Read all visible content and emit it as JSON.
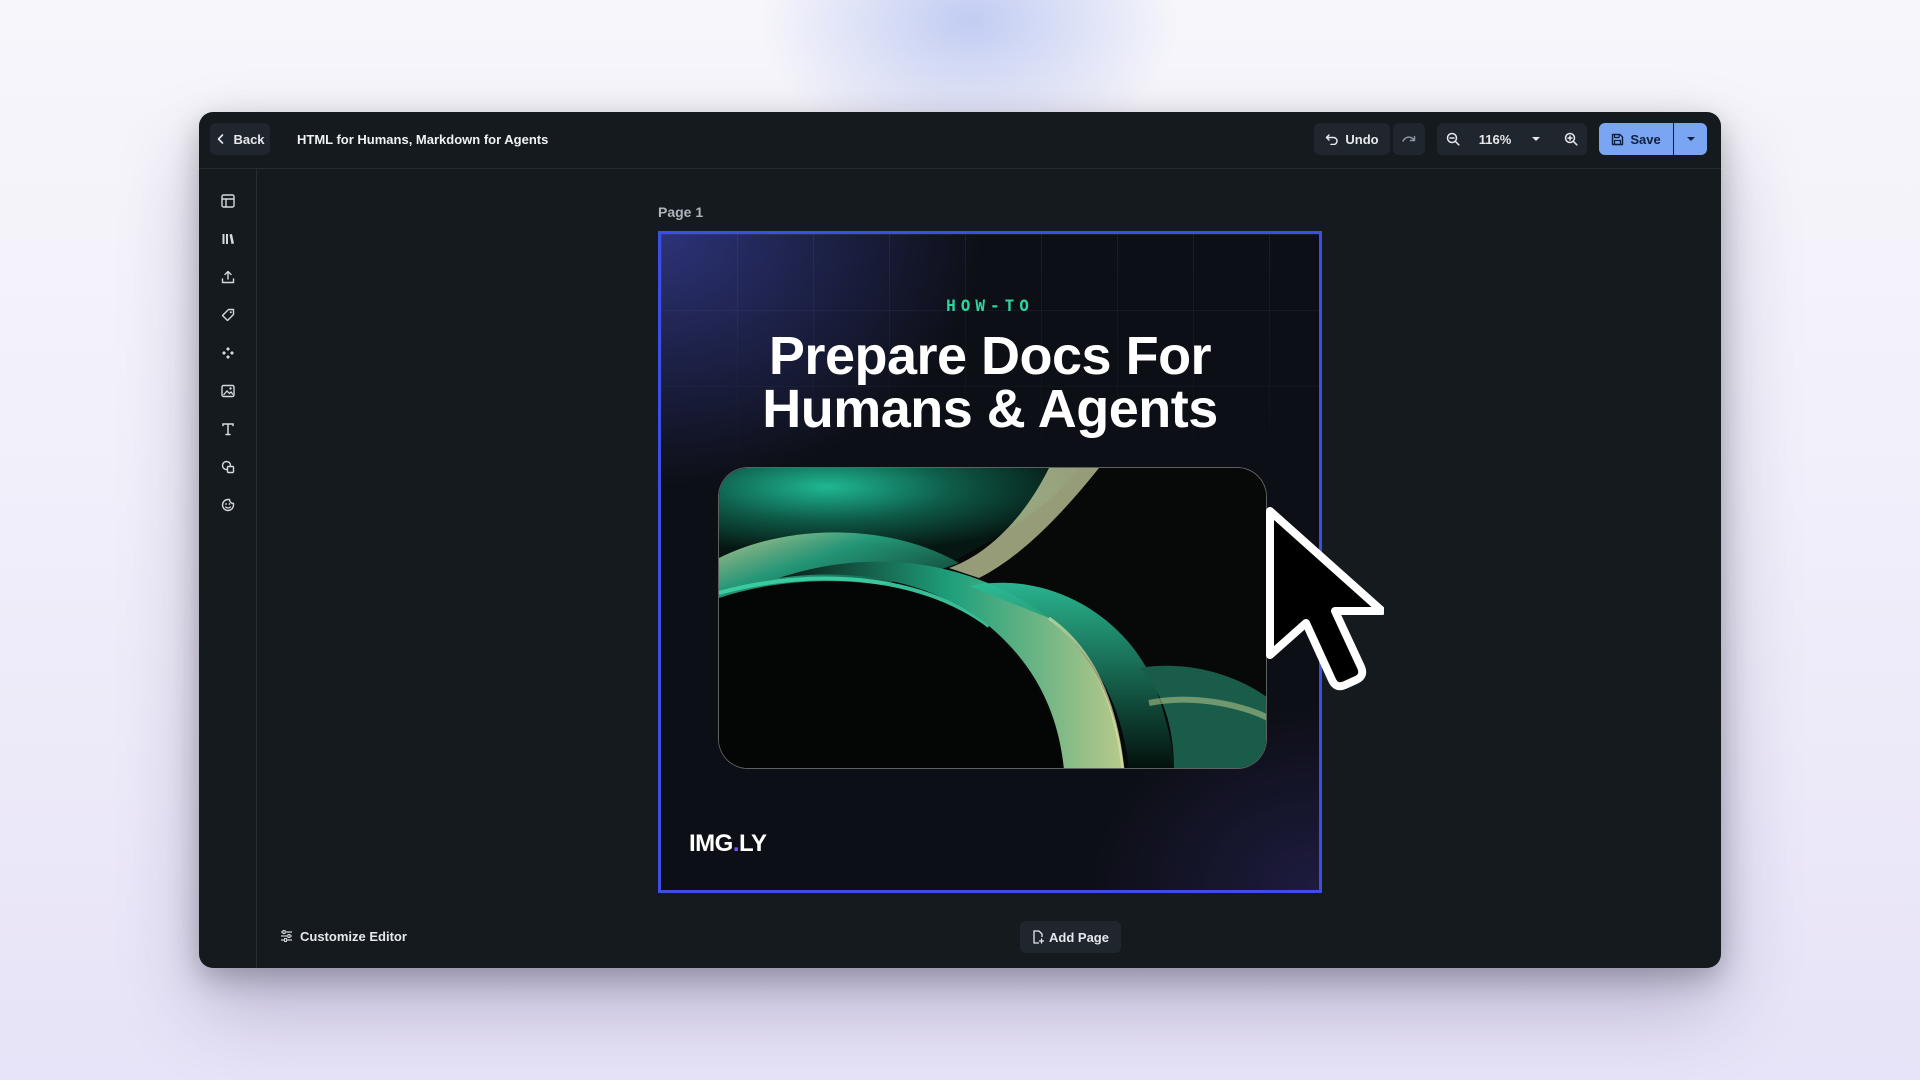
{
  "header": {
    "back_label": "Back",
    "document_title": "HTML for Humans, Markdown for Agents",
    "undo_label": "Undo",
    "zoom_level": "116%",
    "save_label": "Save"
  },
  "sidebar": {
    "items": [
      {
        "icon": "layout-icon"
      },
      {
        "icon": "library-icon"
      },
      {
        "icon": "upload-icon"
      },
      {
        "icon": "tag-icon"
      },
      {
        "icon": "components-icon"
      },
      {
        "icon": "image-icon"
      },
      {
        "icon": "text-icon"
      },
      {
        "icon": "shapes-icon"
      },
      {
        "icon": "sticker-icon"
      }
    ]
  },
  "canvas": {
    "page_label": "Page 1",
    "eyebrow": "HOW-TO",
    "headline_line1": "Prepare Docs For",
    "headline_line2": "Humans & Agents",
    "logo_part1": "IMG",
    "logo_dot": ".",
    "logo_part2": "LY"
  },
  "footer": {
    "customize_label": "Customize Editor",
    "add_page_label": "Add Page"
  },
  "colors": {
    "accent": "#7aa5f2",
    "selection": "#3c4ee6",
    "eyebrow": "#2fd3a0",
    "panel": "#151a1f"
  }
}
